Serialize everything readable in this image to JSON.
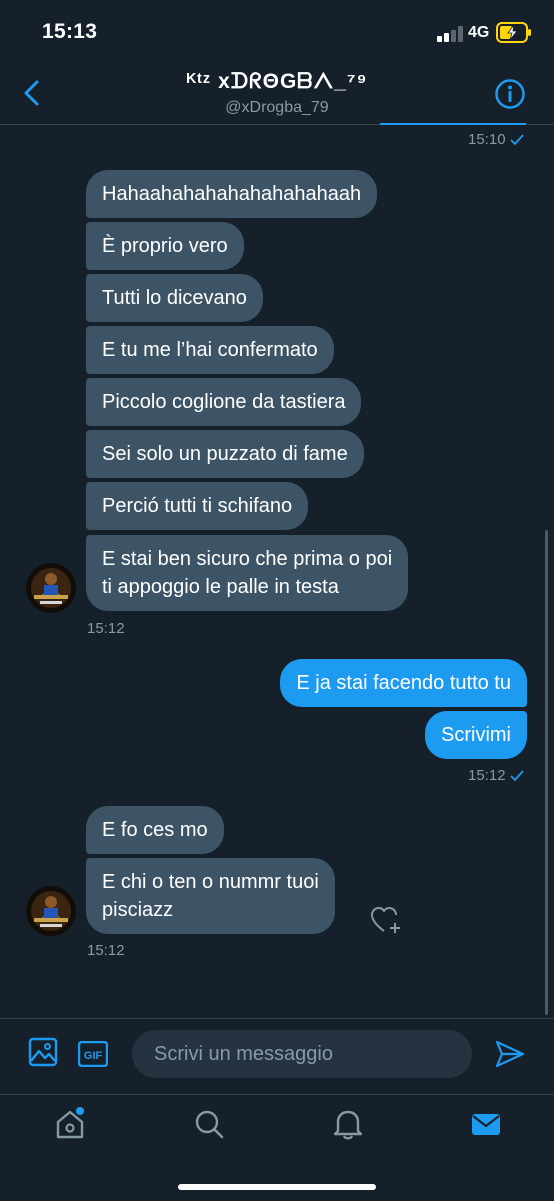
{
  "status_bar": {
    "time": "15:13",
    "network": "4G"
  },
  "header": {
    "title": "ᴷᵗᶻ xᗪᖇΘGᗷᐱ_⁷⁹",
    "handle": "@xDrogba_79"
  },
  "timestamps": {
    "top": "15:10",
    "received_1": "15:12",
    "sent_1": "15:12",
    "received_2": "15:12"
  },
  "messages_received_1": [
    "Hahaahahahahahahahahaah",
    "È proprio vero",
    "Tutti lo dicevano",
    "E tu me l’hai confermato",
    "Piccolo coglione da tastiera",
    "Sei solo un puzzato di fame",
    "Perció tutti ti schifano",
    "E stai ben sicuro che prima o poi\nti appoggio le palle in testa"
  ],
  "messages_sent_1": [
    "E ja stai facendo tutto tu",
    "Scrivimi"
  ],
  "messages_received_2": [
    "E fo ces mo",
    "E chi o ten o nummr tuoi\npisciazz"
  ],
  "composer": {
    "placeholder": "Scrivi un messaggio",
    "gif_label": "GIF"
  },
  "icons": {
    "back": "chevron-left-icon",
    "info": "info-icon",
    "media": "image-icon",
    "gif": "gif-icon",
    "send": "send-icon",
    "react": "heart-plus-icon",
    "tabs": [
      "home-icon",
      "search-icon",
      "bell-icon",
      "mail-icon"
    ]
  },
  "colors": {
    "background": "#15202b",
    "accent": "#1d9bf0",
    "received_bubble": "#3d5466",
    "muted": "#8899a6"
  }
}
